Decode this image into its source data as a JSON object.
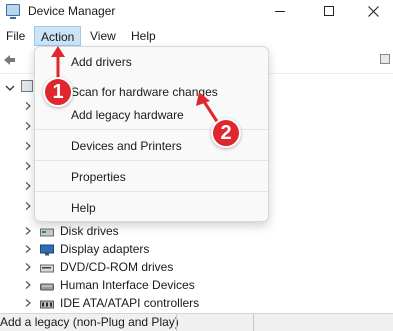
{
  "window": {
    "title": "Device Manager",
    "minimize_icon": "minimize-icon",
    "maximize_icon": "maximize-icon",
    "close_icon": "close-icon"
  },
  "menubar": {
    "items": [
      {
        "label": "File"
      },
      {
        "label": "Action",
        "active": true
      },
      {
        "label": "View"
      },
      {
        "label": "Help"
      }
    ]
  },
  "action_menu": {
    "groups": [
      [
        "Add drivers",
        "Scan for hardware changes",
        "Add legacy hardware"
      ],
      [
        "Devices and Printers"
      ],
      [
        "Properties"
      ],
      [
        "Help"
      ]
    ]
  },
  "device_tree": {
    "categories": [
      {
        "label": "Disk drives",
        "icon": "disk-drive-icon"
      },
      {
        "label": "Display adapters",
        "icon": "display-adapter-icon"
      },
      {
        "label": "DVD/CD-ROM drives",
        "icon": "dvd-drive-icon"
      },
      {
        "label": "Human Interface Devices",
        "icon": "hid-icon"
      },
      {
        "label": "IDE ATA/ATAPI controllers",
        "icon": "ide-controller-icon"
      }
    ]
  },
  "statusbar": {
    "text": "Add a legacy (non-Plug and Play)"
  },
  "annotations": {
    "step1": "1",
    "step2": "2",
    "color": "#e0272e"
  }
}
